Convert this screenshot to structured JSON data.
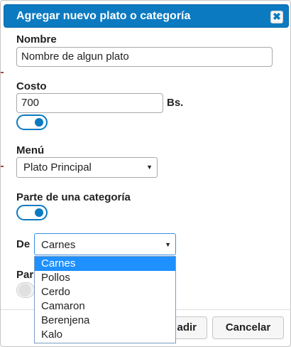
{
  "dialog": {
    "title": "Agregar nuevo plato o categoría",
    "close_label": "✖"
  },
  "form": {
    "nombre_label": "Nombre",
    "nombre_value": "Nombre de algun plato",
    "costo_label": "Costo",
    "costo_value": "700",
    "costo_unit": "Bs.",
    "costo_toggle_on": true,
    "menu_label": "Menú",
    "menu_value": "Plato Principal",
    "categoria_label": "Parte de una categoría",
    "categoria_toggle_on": true,
    "de_label": "De",
    "de_value": "Carnes",
    "hidden_label_fragment": "Par",
    "hidden_toggle_on": false
  },
  "dropdown": {
    "options": [
      "Carnes",
      "Pollos",
      "Cerdo",
      "Camaron",
      "Berenjena",
      "Kalo"
    ],
    "selected_index": 0
  },
  "buttons": {
    "add_label_fragment": "adir",
    "cancel_label": "Cancelar"
  },
  "colors": {
    "accent": "#0c7ac0",
    "selected_option": "#1e90ff"
  }
}
